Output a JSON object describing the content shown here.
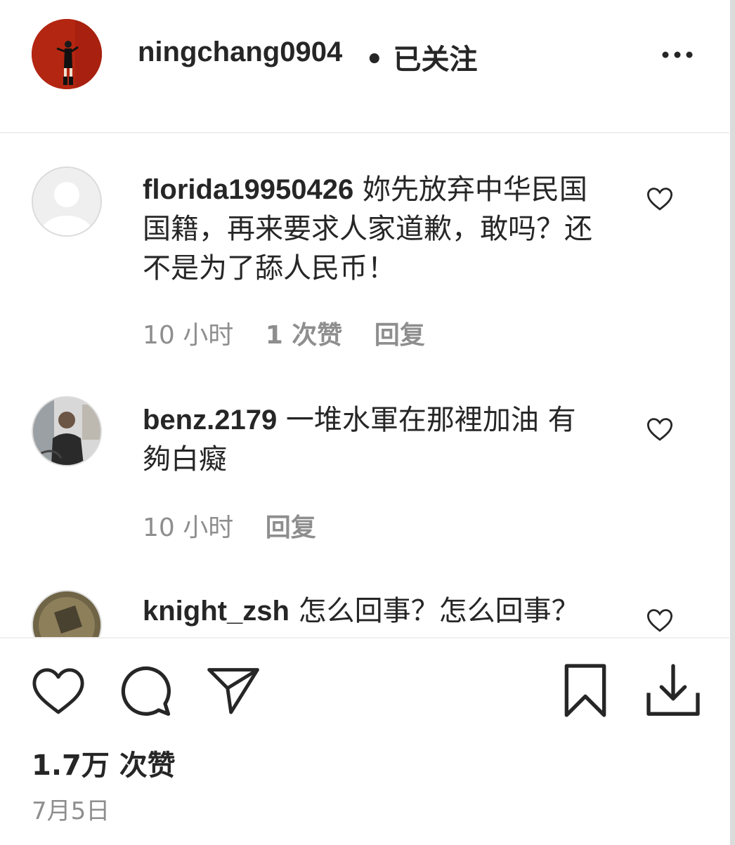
{
  "header": {
    "username": "ningchang0904",
    "follow_status": "• 已关注",
    "more_icon": "more-horizontal-icon"
  },
  "comments": [
    {
      "username": "florida19950426",
      "text": " 妳先放弃中华民国国籍，再来要求人家道歉，敢吗？还不是为了舔人民币！",
      "time": "10 小时",
      "likes": "1 次赞",
      "reply": "回复"
    },
    {
      "username": "benz.2179",
      "text": " 一堆水軍在那裡加油 有夠白癡",
      "time": "10 小时",
      "reply": "回复"
    },
    {
      "username": "knight_zsh",
      "text": " 怎么回事？怎么回事？"
    }
  ],
  "post": {
    "likes_count": "1.7万 次赞",
    "date": "7月5日"
  },
  "colors": {
    "text": "#262626",
    "muted": "#8e8e8e",
    "avatar_red": "#b32612",
    "border": "#efefef"
  }
}
